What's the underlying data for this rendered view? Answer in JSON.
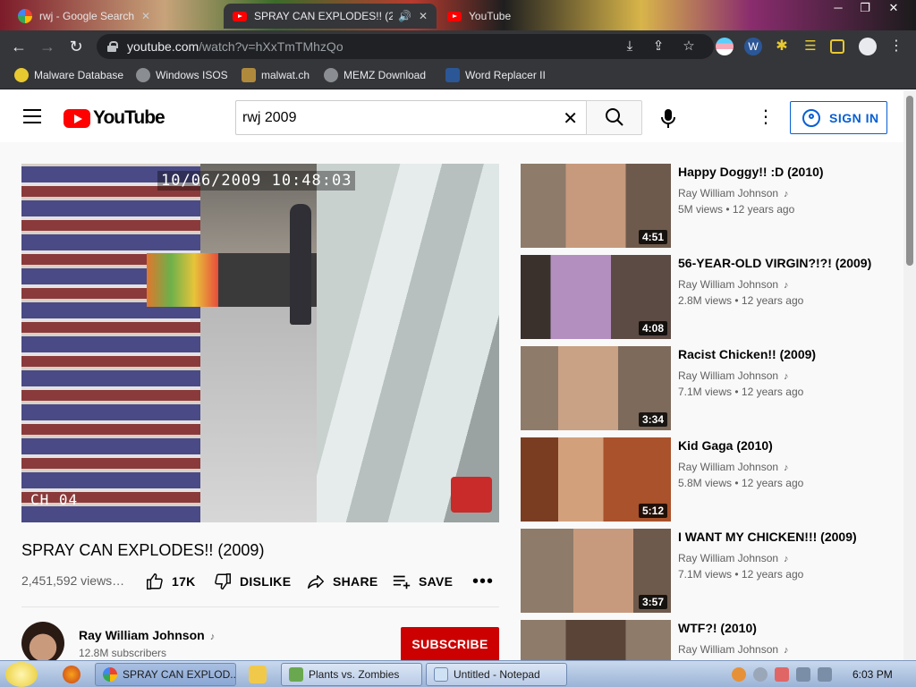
{
  "browser": {
    "tabs": [
      {
        "label": "rwj - Google Search",
        "favicon": "google-icon"
      },
      {
        "label": "SPRAY CAN EXPLODES!! (20",
        "favicon": "youtube-icon",
        "audio": true
      },
      {
        "label": "YouTube",
        "favicon": "youtube-icon"
      }
    ],
    "window_controls": [
      "─",
      "❐",
      "✕"
    ],
    "url_host": "youtube.com",
    "url_path": "/watch?v=hXxTmTMhzQo",
    "bookmarks": [
      {
        "label": "Malware Database"
      },
      {
        "label": "Windows ISOS"
      },
      {
        "label": "malwat.ch"
      },
      {
        "label": "MEMZ Download"
      },
      {
        "label": "Word Replacer II"
      }
    ]
  },
  "youtube": {
    "logo_text": "YouTube",
    "search_value": "rwj 2009",
    "signin_label": "SIGN IN",
    "player": {
      "timestamp": "10/06/2009 10:48:03",
      "channel_overlay": "CH 04"
    },
    "video": {
      "title": "SPRAY CAN EXPLODES!! (2009)",
      "views": "2,451,592 views…",
      "like_count": "17K",
      "dislike_label": "DISLIKE",
      "share_label": "SHARE",
      "save_label": "SAVE",
      "more_label": "•••"
    },
    "channel": {
      "name": "Ray William Johnson",
      "subscribers": "12.8M subscribers",
      "subscribe_label": "SUBSCRIBE"
    },
    "recommendations": [
      {
        "title": "Happy Doggy!! :D (2010)",
        "channel": "Ray William Johnson",
        "views": "5M views",
        "age": "12 years ago",
        "duration": "4:51"
      },
      {
        "title": "56-YEAR-OLD VIRGIN?!?! (2009)",
        "channel": "Ray William Johnson",
        "views": "2.8M views",
        "age": "12 years ago",
        "duration": "4:08"
      },
      {
        "title": "Racist Chicken!! (2009)",
        "channel": "Ray William Johnson",
        "views": "7.1M views",
        "age": "12 years ago",
        "duration": "3:34"
      },
      {
        "title": "Kid Gaga (2010)",
        "channel": "Ray William Johnson",
        "views": "5.8M views",
        "age": "12 years ago",
        "duration": "5:12"
      },
      {
        "title": "I WANT MY CHICKEN!!! (2009)",
        "channel": "Ray William Johnson",
        "views": "7.1M views",
        "age": "12 years ago",
        "duration": "3:57"
      },
      {
        "title": "WTF?! (2010)",
        "channel": "Ray William Johnson",
        "views": "",
        "age": "",
        "duration": ""
      }
    ]
  },
  "taskbar": {
    "tasks": [
      {
        "label": "SPRAY CAN EXPLOD..."
      },
      {
        "label": "Plants vs. Zombies"
      },
      {
        "label": "Untitled - Notepad"
      }
    ],
    "clock": "6:03 PM"
  },
  "colors": {
    "accent_red": "#ff0000",
    "link_blue": "#065fd4",
    "subscribe_red": "#cc0000"
  }
}
